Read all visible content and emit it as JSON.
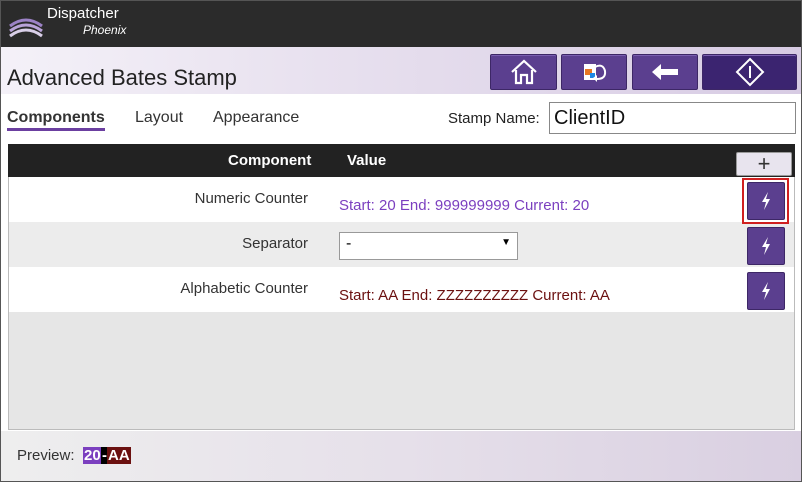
{
  "brand": {
    "name": "Dispatcher",
    "sub": "Phoenix"
  },
  "page_title": "Advanced Bates Stamp",
  "nav": {
    "home_icon": "home-icon",
    "log_icon": "job-log-icon",
    "back_icon": "back-arrow-icon",
    "start_icon": "start-diamond-icon"
  },
  "tabs": [
    {
      "label": "Components",
      "active": true
    },
    {
      "label": "Layout",
      "active": false
    },
    {
      "label": "Appearance",
      "active": false
    }
  ],
  "stamp": {
    "label": "Stamp Name:",
    "value": "ClientID"
  },
  "table": {
    "headers": {
      "component": "Component",
      "value": "Value"
    },
    "add_label": "+",
    "rows": [
      {
        "component": "Numeric Counter",
        "value": "Start: 20 End: 999999999 Current: 20"
      },
      {
        "component": "Separator",
        "value": "-"
      },
      {
        "component": "Alphabetic Counter",
        "value": "Start: AA End: ZZZZZZZZZZ Current: AA"
      }
    ]
  },
  "preview": {
    "label": "Preview:",
    "part1": "20",
    "part2": "-",
    "part3": "AA"
  },
  "colors": {
    "accent": "#5b3f8f",
    "numeric": "#7b3fbf",
    "alpha": "#6b1010"
  }
}
